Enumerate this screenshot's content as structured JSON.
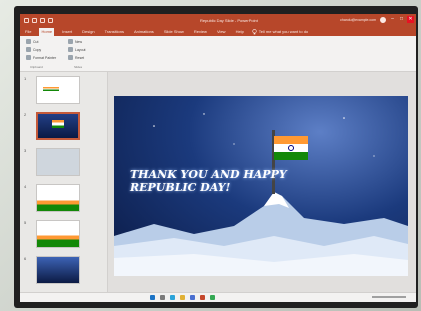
{
  "window": {
    "title": "Republic Day Slide - PowerPoint",
    "account": "chandu@example.com",
    "controls": [
      "–",
      "□",
      "✕"
    ]
  },
  "ribbon": {
    "tabs": [
      "File",
      "Home",
      "Insert",
      "Design",
      "Transitions",
      "Animations",
      "Slide Show",
      "Review",
      "View",
      "Help"
    ],
    "active_tab": "Home",
    "tell_me": "Tell me what you want to do",
    "clipboard": {
      "cut": "Cut",
      "copy": "Copy",
      "format_painter": "Format Painter",
      "group": "Clipboard"
    },
    "slides": {
      "new_slide": "New",
      "layout": "Layout",
      "reset": "Reset",
      "group": "Slides"
    }
  },
  "thumbnails": [
    "1",
    "2",
    "3",
    "4",
    "5",
    "6"
  ],
  "slide": {
    "text_line1": "THANK YOU AND HAPPY",
    "text_line2": "REPUBLIC DAY!"
  },
  "colors": {
    "accent": "#b7472a",
    "saffron": "#ff9933",
    "green": "#138808",
    "navy": "#000080"
  },
  "icons": [
    "save-icon",
    "undo-icon",
    "redo-icon",
    "lightbulb-icon",
    "flag-icon"
  ]
}
